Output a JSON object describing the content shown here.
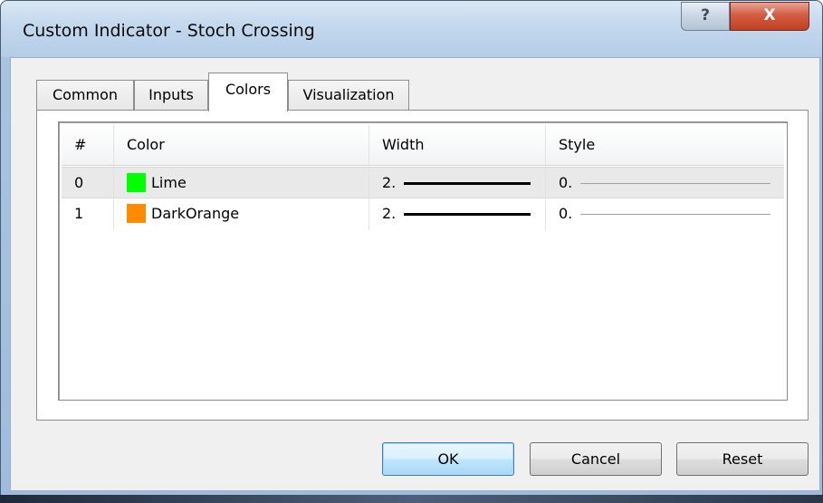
{
  "window": {
    "title": "Custom Indicator - Stoch Crossing",
    "help_glyph": "?",
    "close_glyph": "X"
  },
  "tabs": [
    {
      "label": "Common",
      "active": false
    },
    {
      "label": "Inputs",
      "active": false
    },
    {
      "label": "Colors",
      "active": true
    },
    {
      "label": "Visualization",
      "active": false
    }
  ],
  "table": {
    "columns": [
      "#",
      "Color",
      "Width",
      "Style"
    ],
    "rows": [
      {
        "index": "0",
        "color_name": "Lime",
        "color_hex": "#00ff00",
        "width": "2.",
        "style": "0.",
        "selected": true
      },
      {
        "index": "1",
        "color_name": "DarkOrange",
        "color_hex": "#ff8c00",
        "width": "2.",
        "style": "0.",
        "selected": false
      }
    ]
  },
  "buttons": {
    "ok": "OK",
    "cancel": "Cancel",
    "reset": "Reset"
  },
  "icons": {
    "help": "help-icon",
    "close": "close-icon"
  },
  "colors": {
    "close_button": "#c7492c",
    "default_button_border": "#3c7fb1",
    "selected_row": "#e9e9e9"
  }
}
